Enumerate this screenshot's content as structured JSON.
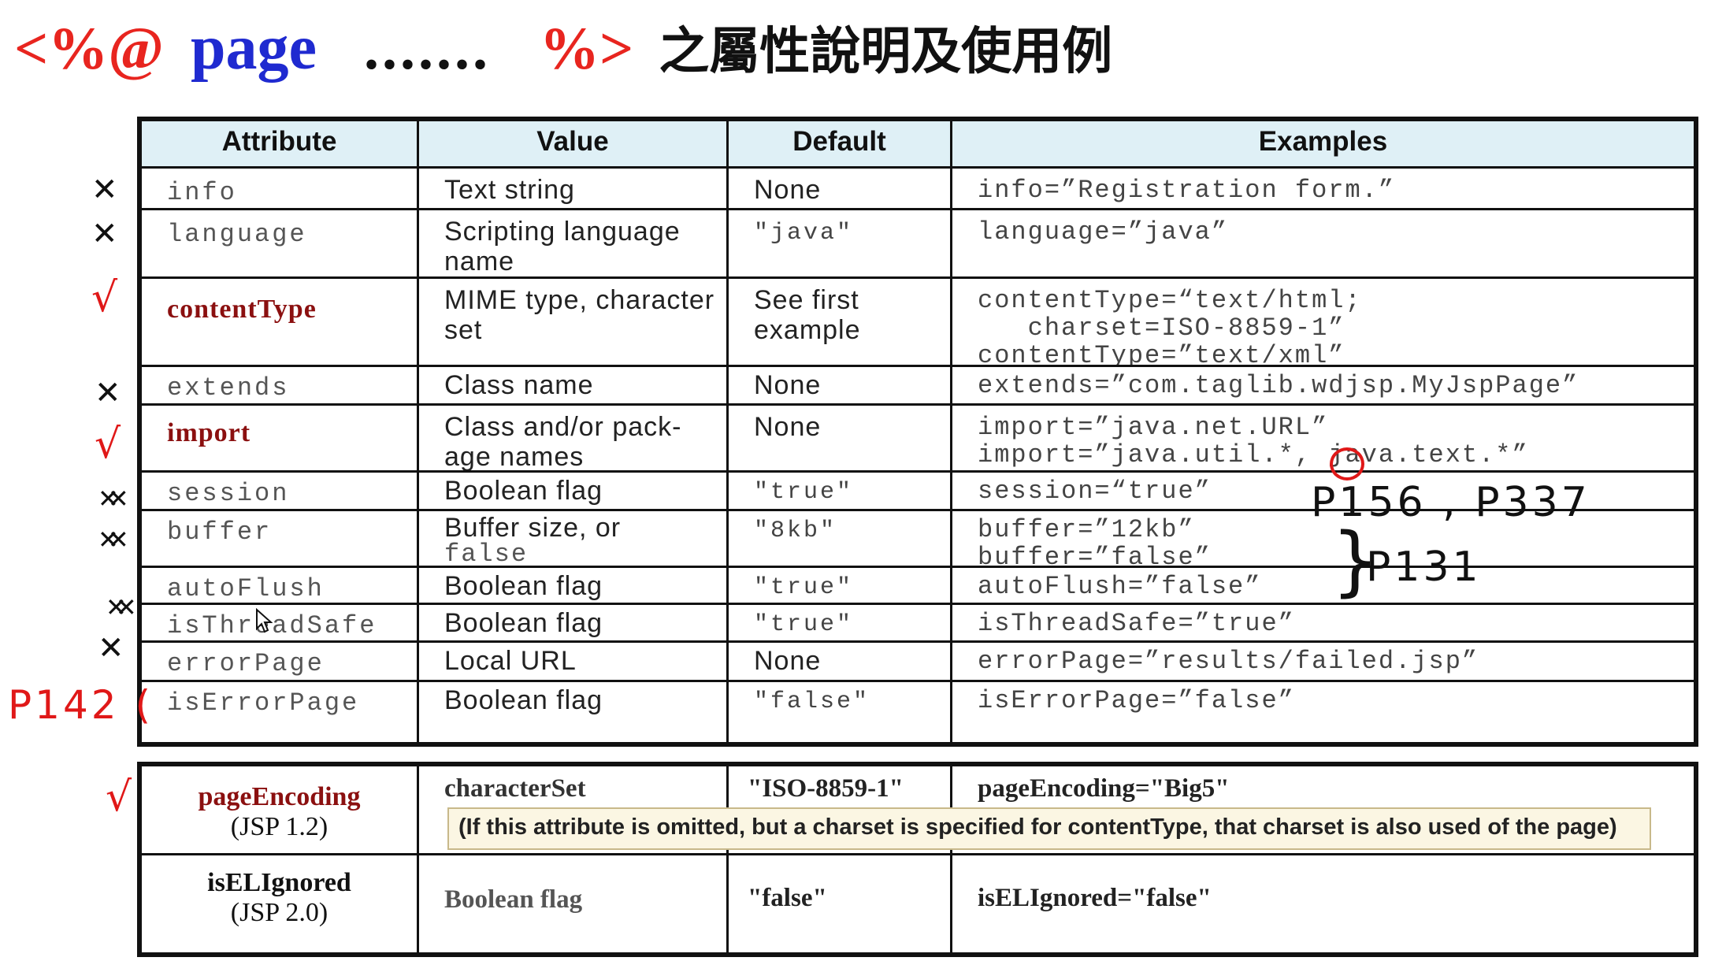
{
  "title": {
    "open": "<%@",
    "page": "page",
    "dots": ".......",
    "close": "%>",
    "zh": "之屬性說明及使用例"
  },
  "headers": [
    "Attribute",
    "Value",
    "Default",
    "Examples"
  ],
  "rows": [
    {
      "attr": "info",
      "value": "Text string",
      "default": "None",
      "example": "info=”Registration form.”"
    },
    {
      "attr": "language",
      "value": "Scripting language name",
      "default": "\"java\"",
      "example": "language=”java”"
    },
    {
      "attr": "contentType",
      "value": "MIME type, character set",
      "default": "See first example",
      "example": "contentType=“text/html;\n   charset=ISO-8859-1”\ncontentType=”text/xml”"
    },
    {
      "attr": "extends",
      "value": "Class name",
      "default": "None",
      "example": "extends=”com.taglib.wdjsp.MyJspPage”"
    },
    {
      "attr": "import",
      "value": "Class and/or pack-age names",
      "default": "None",
      "example": "import=”java.net.URL”\nimport=”java.util.*, java.text.*”"
    },
    {
      "attr": "session",
      "value": "Boolean flag",
      "default": "\"true\"",
      "example": "session=“true”"
    },
    {
      "attr": "buffer",
      "value": "Buffer size, or",
      "value_mono": "false",
      "default": "\"8kb\"",
      "example": "buffer=”12kb”\nbuffer=”false”"
    },
    {
      "attr": "autoFlush",
      "value": "Boolean flag",
      "default": "\"true\"",
      "example": "autoFlush=”false”"
    },
    {
      "attr": "isThreadSafe",
      "value": "Boolean flag",
      "default": "\"true\"",
      "example": "isThreadSafe=”true”"
    },
    {
      "attr": "errorPage",
      "value": "Local URL",
      "default": "None",
      "example": "errorPage=”results/failed.jsp”"
    },
    {
      "attr": "isErrorPage",
      "value": "Boolean flag",
      "default": "\"false\"",
      "example": "isErrorPage=”false”"
    }
  ],
  "extra": {
    "page_encoding": {
      "attr": "pageEncoding",
      "version": "(JSP 1.2)",
      "value": "characterSet",
      "default": "\"ISO-8859-1\"",
      "example": "pageEncoding=\"Big5\"",
      "note": "(If this attribute is omitted,  but a charset is specified for contentType,  that charset is also used of the page)"
    },
    "el_ignored": {
      "attr": "isELIgnored",
      "version": "(JSP 2.0)",
      "value": "Boolean flag",
      "default": "\"false\"",
      "example": "isELIgnored=\"false\""
    }
  },
  "annotations": {
    "p156": "P156 , P337",
    "p131": "P131",
    "p142": "P142 (",
    "brace": "}",
    "check": "√",
    "cross": "✕",
    "double_cross": "✕✕",
    "circle_comma": ","
  },
  "colors": {
    "accent_red": "#e8251f",
    "page_blue": "#1f2ad0",
    "header_bg": "#dff0f6",
    "emph_attr": "#8b1010",
    "note_bg": "#fbf6e3"
  }
}
